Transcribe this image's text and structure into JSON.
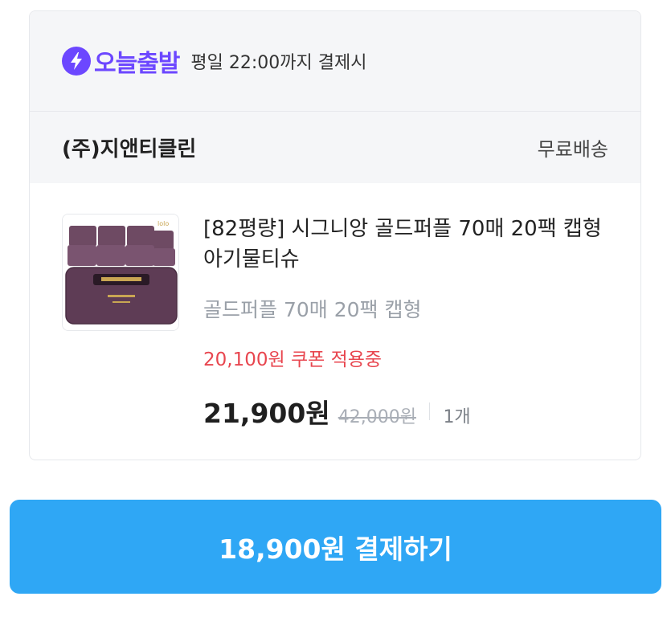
{
  "delivery": {
    "icon": "bolt-icon",
    "brand": "오늘출발",
    "cutoff": "평일 22:00까지 결제시",
    "brand_color": "#6c47ff"
  },
  "seller": {
    "name": "(주)지앤티클린",
    "shipping": "무료배송"
  },
  "product": {
    "name": "[82평량] 시그니앙 골드퍼플 70매 20팩 캡형 아기물티슈",
    "option": "골드퍼플 70매 20팩 캡형",
    "coupon": "20,100원 쿠폰 적용중",
    "price": "21,900원",
    "original_price": "42,000원",
    "quantity": "1개",
    "coupon_color": "#e8464f"
  },
  "payment": {
    "button_label": "18,900원 결제하기",
    "button_color": "#2fa7f5"
  }
}
